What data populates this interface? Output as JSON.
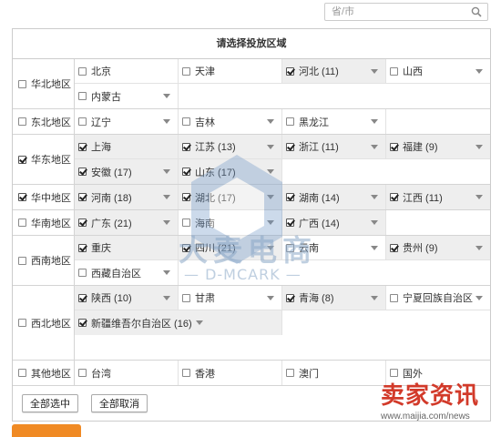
{
  "search": {
    "placeholder": "省/市"
  },
  "panel": {
    "title": "请选择投放区域"
  },
  "regions": [
    {
      "name": "华北地区",
      "checked": false,
      "cells": [
        {
          "label": "北京",
          "checked": false,
          "dropdown": false
        },
        {
          "label": "天津",
          "checked": false,
          "dropdown": false
        },
        {
          "label": "河北 (11)",
          "checked": true,
          "dropdown": true
        },
        {
          "label": "山西",
          "checked": false,
          "dropdown": true
        },
        {
          "label": "内蒙古",
          "checked": false,
          "dropdown": true
        }
      ]
    },
    {
      "name": "东北地区",
      "checked": false,
      "cells": [
        {
          "label": "辽宁",
          "checked": false,
          "dropdown": true
        },
        {
          "label": "吉林",
          "checked": false,
          "dropdown": true
        },
        {
          "label": "黑龙江",
          "checked": false,
          "dropdown": true
        }
      ]
    },
    {
      "name": "华东地区",
      "checked": true,
      "cells": [
        {
          "label": "上海",
          "checked": true,
          "dropdown": false
        },
        {
          "label": "江苏 (13)",
          "checked": true,
          "dropdown": true
        },
        {
          "label": "浙江 (11)",
          "checked": true,
          "dropdown": true
        },
        {
          "label": "福建 (9)",
          "checked": true,
          "dropdown": true
        },
        {
          "label": "安徽 (17)",
          "checked": true,
          "dropdown": true
        },
        {
          "label": "山东 (17)",
          "checked": true,
          "dropdown": true
        }
      ]
    },
    {
      "name": "华中地区",
      "checked": true,
      "cells": [
        {
          "label": "河南 (18)",
          "checked": true,
          "dropdown": true
        },
        {
          "label": "湖北 (17)",
          "checked": true,
          "dropdown": true
        },
        {
          "label": "湖南 (14)",
          "checked": true,
          "dropdown": true
        },
        {
          "label": "江西 (11)",
          "checked": true,
          "dropdown": true
        }
      ]
    },
    {
      "name": "华南地区",
      "checked": false,
      "cells": [
        {
          "label": "广东 (21)",
          "checked": true,
          "dropdown": true
        },
        {
          "label": "海南",
          "checked": false,
          "dropdown": true
        },
        {
          "label": "广西 (14)",
          "checked": true,
          "dropdown": true
        }
      ]
    },
    {
      "name": "西南地区",
      "checked": false,
      "cells": [
        {
          "label": "重庆",
          "checked": true,
          "dropdown": false
        },
        {
          "label": "四川 (21)",
          "checked": true,
          "dropdown": true
        },
        {
          "label": "云南",
          "checked": false,
          "dropdown": true
        },
        {
          "label": "贵州 (9)",
          "checked": true,
          "dropdown": true
        },
        {
          "label": "西藏自治区",
          "checked": false,
          "dropdown": true
        }
      ]
    },
    {
      "name": "西北地区",
      "checked": false,
      "cells": [
        {
          "label": "陕西 (10)",
          "checked": true,
          "dropdown": true
        },
        {
          "label": "甘肃",
          "checked": false,
          "dropdown": true
        },
        {
          "label": "青海 (8)",
          "checked": true,
          "dropdown": true
        },
        {
          "label": "宁夏回族自治区",
          "checked": false,
          "dropdown": true
        },
        {
          "label": "新疆维吾尔自治区 (16)",
          "checked": true,
          "dropdown": true,
          "wide": true
        }
      ]
    },
    {
      "name": "其他地区",
      "checked": false,
      "cells": [
        {
          "label": "台湾",
          "checked": false,
          "dropdown": false
        },
        {
          "label": "香港",
          "checked": false,
          "dropdown": false
        },
        {
          "label": "澳门",
          "checked": false,
          "dropdown": false
        },
        {
          "label": "国外",
          "checked": false,
          "dropdown": false
        }
      ]
    }
  ],
  "buttons": {
    "select_all": "全部选中",
    "cancel_all": "全部取消"
  },
  "watermark": {
    "main": "大麦电商",
    "sub": "— D-MCARK —"
  },
  "logo": {
    "title": "卖家资讯",
    "url": "www.maijia.com/news"
  },
  "colors": {
    "selected_bg": "#eeeeee",
    "border": "#cccccc",
    "accent": "#f08a24",
    "logo_red": "#d23a2a"
  }
}
